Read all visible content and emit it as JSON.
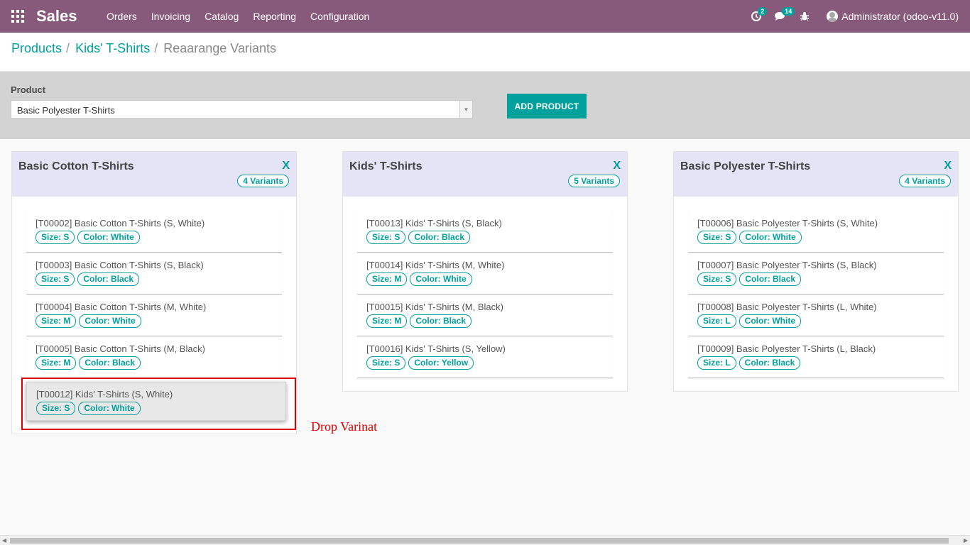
{
  "navbar": {
    "app_name": "Sales",
    "menu": [
      "Orders",
      "Invoicing",
      "Catalog",
      "Reporting",
      "Configuration"
    ],
    "activity_badge": "2",
    "messages_badge": "14",
    "user": "Administrator (odoo-v11.0)",
    "bg_color": "#875a7b"
  },
  "breadcrumb": {
    "items": [
      "Products",
      "Kids' T-Shirts"
    ],
    "separator": "/",
    "current": "Reaarange Variants"
  },
  "chooser": {
    "label": "Product",
    "selected": "Basic Polyester T-Shirts",
    "add_button": "ADD PRODUCT"
  },
  "columns": [
    {
      "title": "Basic Cotton T-Shirts",
      "close": "X",
      "count": "4 Variants",
      "variants": [
        {
          "name": "[T00002] Basic Cotton T-Shirts (S, White)",
          "size": "Size: S",
          "color": "Color: White"
        },
        {
          "name": "[T00003] Basic Cotton T-Shirts (S, Black)",
          "size": "Size: S",
          "color": "Color: Black"
        },
        {
          "name": "[T00004] Basic Cotton T-Shirts (M, White)",
          "size": "Size: M",
          "color": "Color: White"
        },
        {
          "name": "[T00005] Basic Cotton T-Shirts (M, Black)",
          "size": "Size: M",
          "color": "Color: Black"
        }
      ]
    },
    {
      "title": "Kids' T-Shirts",
      "close": "X",
      "count": "5 Variants",
      "variants": [
        {
          "name": "[T00013] Kids' T-Shirts (S, Black)",
          "size": "Size: S",
          "color": "Color: Black"
        },
        {
          "name": "[T00014] Kids' T-Shirts (M, White)",
          "size": "Size: M",
          "color": "Color: White"
        },
        {
          "name": "[T00015] Kids' T-Shirts (M, Black)",
          "size": "Size: M",
          "color": "Color: Black"
        },
        {
          "name": "[T00016] Kids' T-Shirts (S, Yellow)",
          "size": "Size: S",
          "color": "Color: Yellow"
        }
      ]
    },
    {
      "title": "Basic Polyester T-Shirts",
      "close": "X",
      "count": "4 Variants",
      "variants": [
        {
          "name": "[T00006] Basic Polyester T-Shirts (S, White)",
          "size": "Size: S",
          "color": "Color: White"
        },
        {
          "name": "[T00007] Basic Polyester T-Shirts (S, Black)",
          "size": "Size: S",
          "color": "Color: Black"
        },
        {
          "name": "[T00008] Basic Polyester T-Shirts (L, White)",
          "size": "Size: L",
          "color": "Color: White"
        },
        {
          "name": "[T00009] Basic Polyester T-Shirts (L, Black)",
          "size": "Size: L",
          "color": "Color: Black"
        }
      ]
    }
  ],
  "dragging_variant": {
    "name": "[T00012] Kids' T-Shirts (S, White)",
    "size": "Size: S",
    "color": "Color: White"
  },
  "drop_annotation": "Drop Varinat",
  "accent_color": "#00a09d",
  "annotation_color": "#e00000"
}
